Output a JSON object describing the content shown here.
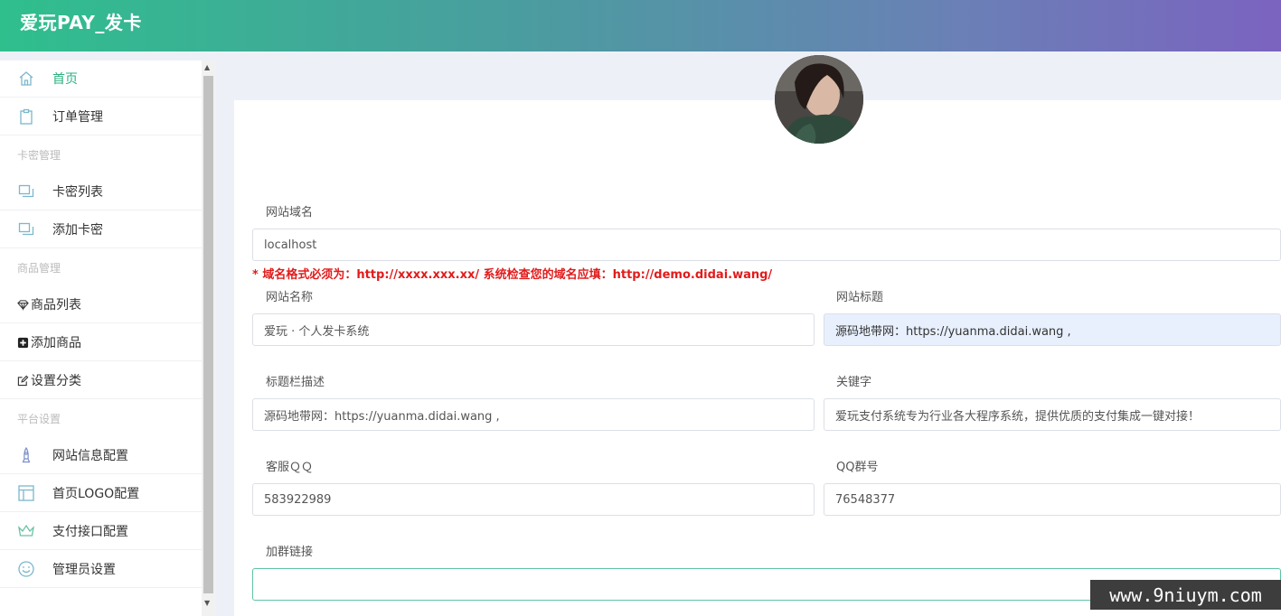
{
  "app": {
    "title": "爱玩PAY_发卡"
  },
  "sidebar": {
    "items": [
      {
        "label": "首页",
        "icon": "home-icon",
        "active": true
      },
      {
        "label": "订单管理",
        "icon": "clipboard-icon"
      },
      {
        "label": "卡密列表",
        "icon": "cards-icon"
      },
      {
        "label": "添加卡密",
        "icon": "cards-icon"
      },
      {
        "label": "商品列表",
        "icon": "diamond-icon"
      },
      {
        "label": "添加商品",
        "icon": "plus-square-icon"
      },
      {
        "label": "设置分类",
        "icon": "edit-icon"
      },
      {
        "label": "网站信息配置",
        "icon": "rocket-icon"
      },
      {
        "label": "首页LOGO配置",
        "icon": "layout-icon"
      },
      {
        "label": "支付接口配置",
        "icon": "crown-icon"
      },
      {
        "label": "管理员设置",
        "icon": "smile-icon"
      }
    ],
    "sections": [
      "卡密管理",
      "商品管理",
      "平台设置"
    ]
  },
  "form": {
    "domain": {
      "label": "网站域名",
      "value": "localhost"
    },
    "domain_hint": "* 域名格式必须为：http://xxxx.xxx.xx/ 系统检查您的域名应填：http://demo.didai.wang/",
    "site_name": {
      "label": "网站名称",
      "value": "爱玩 · 个人发卡系统"
    },
    "site_title": {
      "label": "网站标题",
      "value": "源码地带网：https://yuanma.didai.wang ,"
    },
    "title_desc": {
      "label": "标题栏描述",
      "value": "源码地带网：https://yuanma.didai.wang ,"
    },
    "keywords": {
      "label": "关键字",
      "value": "爱玩支付系统专为行业各大程序系统，提供优质的支付集成一键对接！"
    },
    "service_qq": {
      "label": "客服ＱＱ",
      "value": "583922989"
    },
    "qq_group": {
      "label": "QQ群号",
      "value": "76548377"
    },
    "group_link": {
      "label": "加群链接",
      "value": ""
    }
  },
  "watermark": "www.9niuym.com",
  "colors": {
    "accent": "#2ab07f",
    "hint": "#e21b1b",
    "header_start": "#2fbf8d",
    "header_end": "#7b63c0"
  }
}
